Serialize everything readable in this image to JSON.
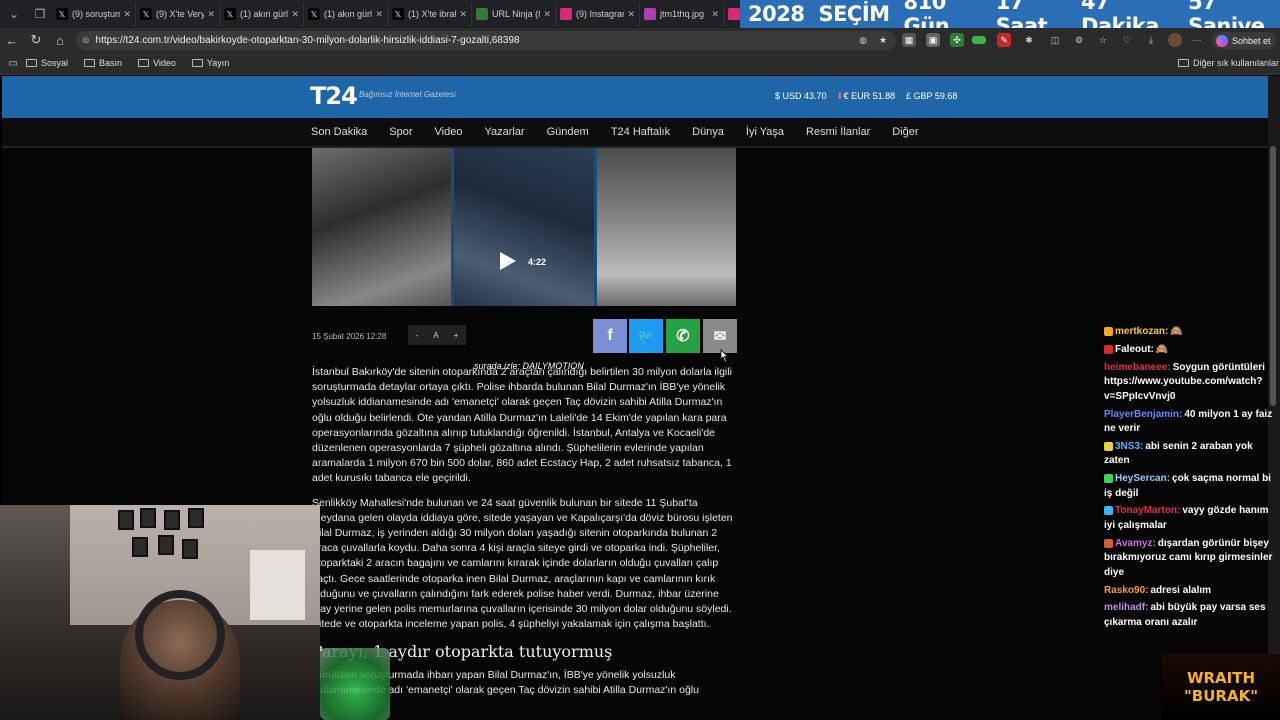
{
  "tabs": [
    {
      "label": "(9) soruşturm",
      "icon": "x-icon",
      "color": "#000000"
    },
    {
      "label": "(9) X'te Veryz",
      "icon": "x-icon",
      "color": "#000000"
    },
    {
      "label": "(1) akın gürle",
      "icon": "x-icon",
      "color": "#000000"
    },
    {
      "label": "(1) akın gürle",
      "icon": "x-icon",
      "color": "#000000"
    },
    {
      "label": "(1) X'te ibrah",
      "icon": "x-icon",
      "color": "#000000"
    },
    {
      "label": "URL Ninja (8",
      "icon": "url-ninja-icon",
      "color": "#2e7d32"
    },
    {
      "label": "(9) Instagram",
      "icon": "instagram-icon",
      "color": "#d62976"
    },
    {
      "label": "jtm1thq.jpg",
      "icon": "image-icon",
      "color": "#b03fb5"
    },
    {
      "label": "",
      "icon": "instagram-icon",
      "color": "#d62976"
    }
  ],
  "countdown": {
    "election": "2028",
    "title": "SEÇİM",
    "days": "810 Gün",
    "hours": "17 Saat",
    "minutes": "47 Dakika",
    "seconds": "57 Saniye"
  },
  "address": {
    "url": "https://t24.com.tr/video/bakirkoyde-otoparktan-30-milyon-dolarlik-hirsizlik-iddiasi-7-gozalti,68398",
    "copilot": "Sohbet et"
  },
  "bookmarks": {
    "items": [
      "Sosyal",
      "Basın",
      "Video",
      "Yayın"
    ],
    "other": "Diğer sık kullanılanlar"
  },
  "site": {
    "logo": "T24",
    "tagline": "Bağımsız İnternet Gazetesi",
    "currency": {
      "usd": "USD 43.70",
      "eur": "EUR 51.88",
      "gbp": "GBP 59.68"
    },
    "menu": [
      "Son Dakika",
      "Spor",
      "Video",
      "Yazarlar",
      "Gündem",
      "T24 Haftalık",
      "Dünya",
      "İyi Yaşa",
      "Resmi İlanlar",
      "Diğer"
    ]
  },
  "video": {
    "duration": "4:22",
    "watch_on": "şurada izle: DAILYMOTION"
  },
  "article": {
    "date": "15 Şubat 2026 12:28",
    "font_minus": "-",
    "font_a": "A",
    "font_plus": "+",
    "p1": "İstanbul Bakırköy'de  sitenin otoparkında 2 araçtan çalındığı belirtilen 30 milyon dolarla ilgili soruşturmada detaylar ortaya çıktı. Polise ihbarda bulunan Bilal Durmaz'ın İBB'ye yönelik yolsuzluk iddianamesinde adı 'emanetçi' olarak geçen Taç dövizin sahibi Atilla Durmaz'ın oğlu olduğu belirlendi. Öte yandan Atilla Durmaz'ın Laleli'de 14 Ekim'de yapılan kara para operasyonlarında gözaltına alınıp tutuklandığı öğrenildi. İstanbul, Antalya ve Kocaeli'de düzenlenen operasyonlarda 7 şüpheli gözaltına alındı. Şüphelilerin evlerinde yapılan aramalarda 1 milyon 670 bin 500 dolar, 860 adet Ecstacy Hap, 2 adet ruhsatsız tabanca, 1 adet kurusıkı tabanca ele geçirildi.",
    "p2": "Şenlikköy Mahallesi'nde bulunan ve 24 saat güvenlik bulunan bir sitede 11 Şubat'ta meydana gelen olayda iddiaya göre, sitede yaşayan ve Kapalıçarşı'da döviz bürosu işleten Bilal Durmaz, iş yerinden aldığı 30 milyon doları yaşadığı sitenin otoparkında bulunan 2 araca çuvallarla koydu. Daha sonra 4 kişi araçla siteye girdi ve otoparka indi. Şüpheliler, otoparktaki 2 aracın bagajını ve camlarını kırarak içinde dolarların olduğu çuvalları çalıp kaçtı. Gece saatlerinde otoparka inen Bilal Durmaz, araçlarının kapı ve camlarının kırık olduğunu ve çuvalların çalındığını fark ederek polise haber verdi. Durmaz, ihbar üzerine olay yerine gelen polis memurlarına çuvalların içerisinde 30 milyon dolar olduğunu söyledi. Sitede ve otoparkta inceleme yapan polis, 4 şüpheliyi yakalamak için çalışma başlattı.",
    "subhead": "Parayı, 1 aydır otoparkta tutuyormuş",
    "p3": "Yürütülen soruşturmada ihbarı yapan Bilal Durmaz'ın, İBB'ye yönelik yolsuzluk iddianamesinde adı 'emanetçi' olarak geçen Taç dövizin sahibi Atilla Durmaz'ın oğlu"
  },
  "chat": [
    {
      "user": "mertkozan:",
      "msg": "🙈",
      "color": "#f5c842",
      "badge": "#f5a623"
    },
    {
      "user": "Faleout:",
      "msg": "🙈",
      "color": "#ffffff",
      "badge": "#d62b2b"
    },
    {
      "user": "heimebaneee:",
      "msg": "Soygun görüntüleri https://www.youtube.com/watch?v=SPpIcvVnvj0",
      "color": "#e0304a",
      "badge": ""
    },
    {
      "user": "PlayerBenjamin:",
      "msg": "40 milyon 1 ay faiz ne verir",
      "color": "#5a8cff",
      "badge": ""
    },
    {
      "user": "3NS3:",
      "msg": "abi senin 2 araban yok zaten",
      "color": "#5ab0ff",
      "badge": "#e8d23a"
    },
    {
      "user": "HeySercan:",
      "msg": "çok saçma normal bi iş değil",
      "color": "#8fd0ff",
      "badge": "#3bd05a"
    },
    {
      "user": "TonayMarton:",
      "msg": "vayy gözde hanım iyi çalışmalar",
      "color": "#e0304a",
      "badge": "#3ab5ff"
    },
    {
      "user": "Avamyz:",
      "msg": "dışardan görünür bişey bırakmıyoruz camı kırıp girmesinler diye",
      "color": "#c86fe8",
      "badge": "#d65a3a"
    },
    {
      "user": "Rasko90:",
      "msg": "adresi alalım",
      "color": "#f0a030",
      "badge": ""
    },
    {
      "user": "melihadf:",
      "msg": "abi büyük pay varsa ses çıkarma oranı azalır",
      "color": "#c28be8",
      "badge": ""
    }
  ],
  "overlay": {
    "line1": "WRAITH",
    "line2": "\"BURAK\""
  }
}
